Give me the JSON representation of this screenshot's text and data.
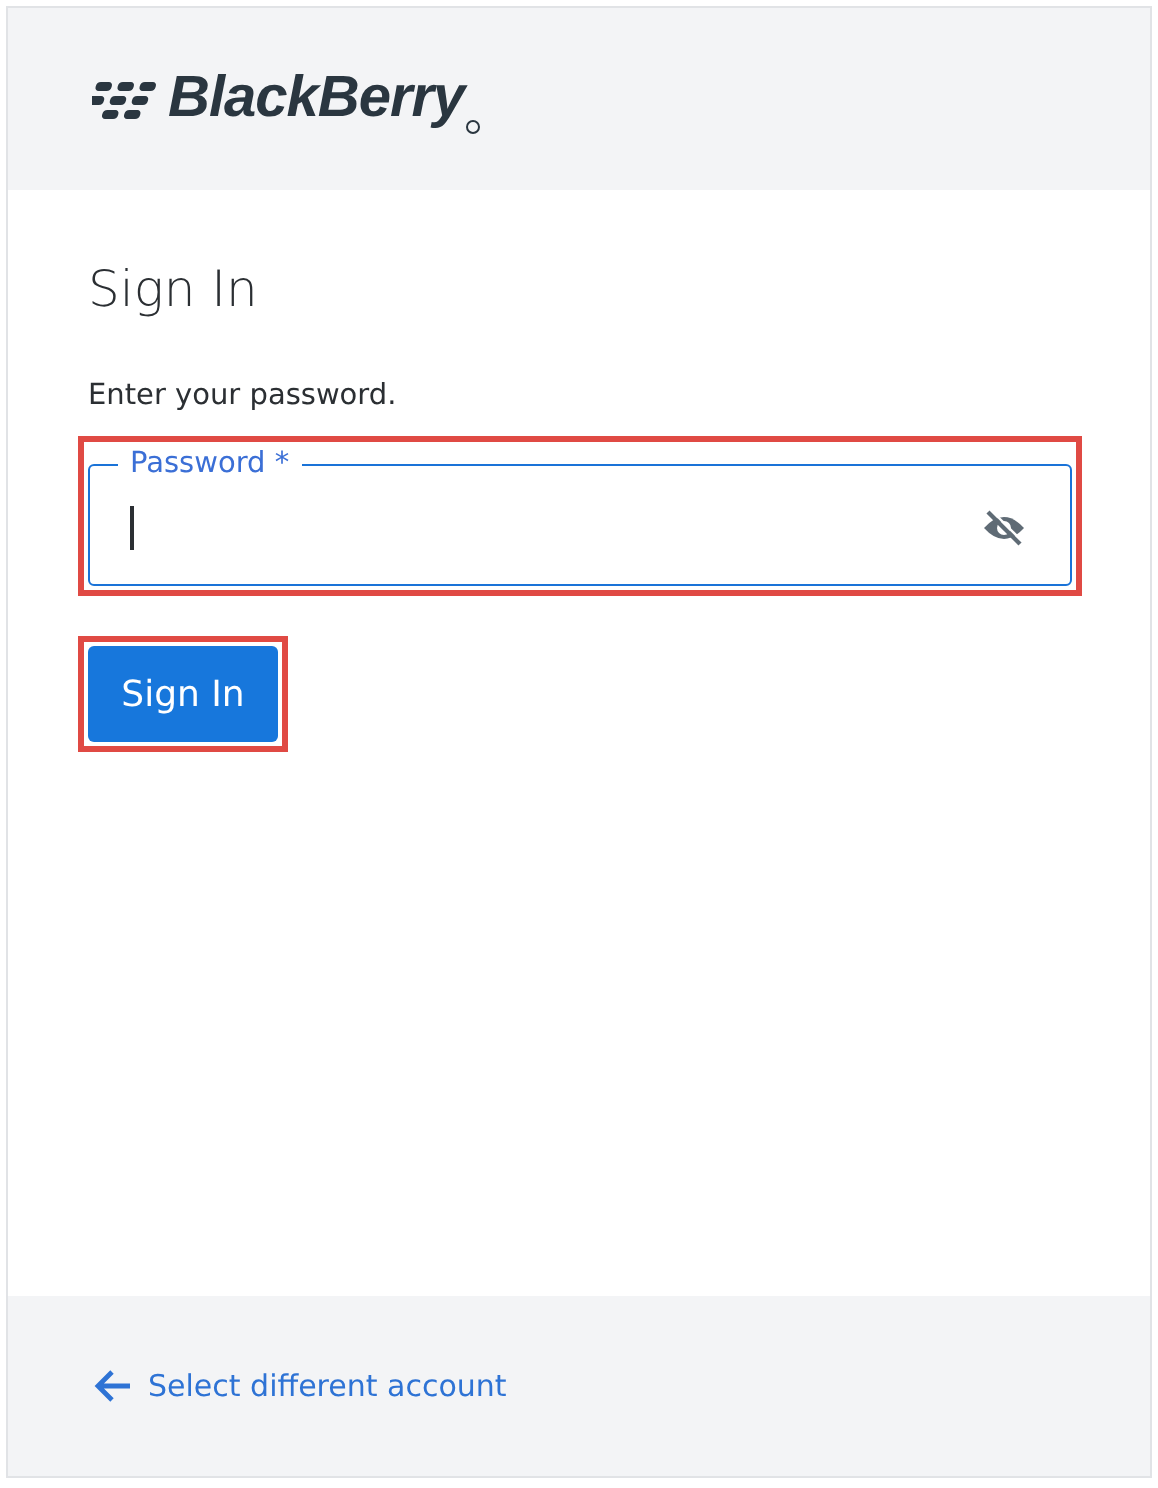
{
  "header": {
    "logo": "BlackBerry"
  },
  "title": "Sign In",
  "prompt": "Enter your password.",
  "password_field": {
    "label": "Password *",
    "highlighted": true,
    "focused": true
  },
  "sign_in_button": {
    "label": "Sign In",
    "highlighted": true
  },
  "footer": {
    "link": "Select different account"
  }
}
